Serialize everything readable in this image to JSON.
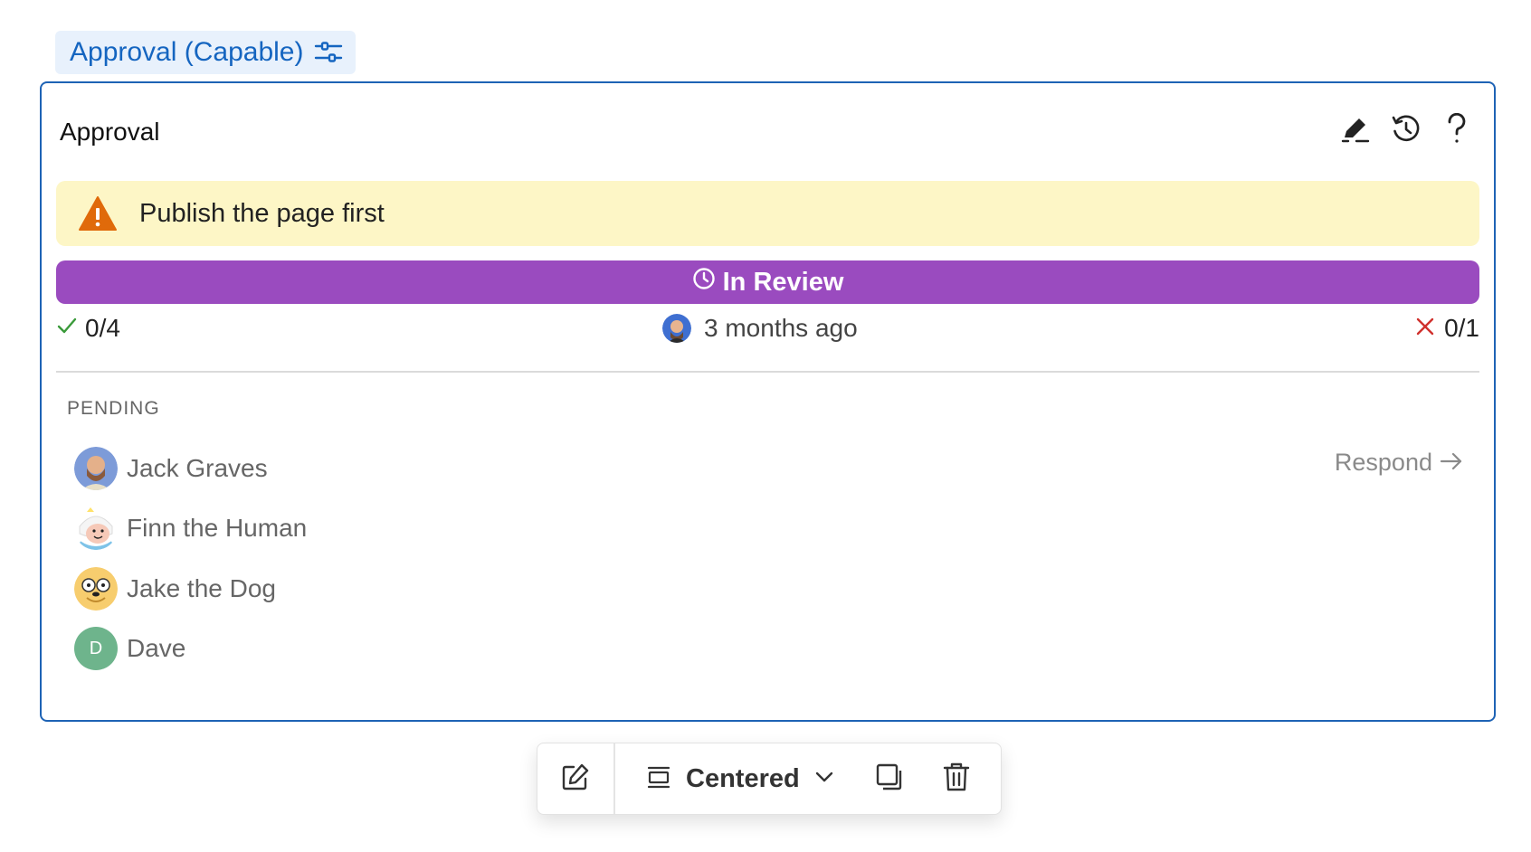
{
  "block_tag": {
    "label": "Approval (Capable)",
    "icon": "sliders-icon"
  },
  "card": {
    "title": "Approval",
    "actions": [
      {
        "name": "edit-pen-icon"
      },
      {
        "name": "history-icon"
      },
      {
        "name": "help-icon"
      }
    ],
    "warning": {
      "text": "Publish the page first",
      "icon": "warning-triangle-icon",
      "color": "#e06a0a"
    },
    "status": {
      "label": "In Review",
      "icon": "clock-icon",
      "color": "#9a4bbf"
    },
    "metrics": {
      "approved": "0/4",
      "time": "3 months ago",
      "rejected": "0/1"
    },
    "pending_heading": "PENDING",
    "reviewers": [
      {
        "name": "Jack Graves",
        "initial": ""
      },
      {
        "name": "Finn the Human",
        "initial": ""
      },
      {
        "name": "Jake the Dog",
        "initial": ""
      },
      {
        "name": "Dave",
        "initial": "D"
      }
    ],
    "respond_label": "Respond"
  },
  "toolbar": {
    "alignment": "Centered"
  },
  "colors": {
    "accent_blue": "#1565c0",
    "success": "#3a9a3a",
    "danger": "#d0312d"
  }
}
